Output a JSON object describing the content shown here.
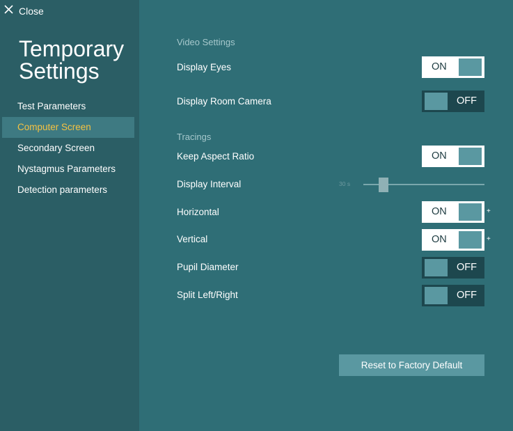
{
  "header": {
    "close_label": "Close"
  },
  "sidebar": {
    "title_line1": "Temporary",
    "title_line2": "Settings",
    "items": [
      {
        "label": "Test Parameters",
        "active": false
      },
      {
        "label": "Computer Screen",
        "active": true
      },
      {
        "label": "Secondary Screen",
        "active": false
      },
      {
        "label": "Nystagmus Parameters",
        "active": false
      },
      {
        "label": "Detection parameters",
        "active": false
      }
    ]
  },
  "video_settings": {
    "heading": "Video Settings",
    "display_eyes": {
      "label": "Display Eyes",
      "state": "ON"
    },
    "display_room_camera": {
      "label": "Display Room Camera",
      "state": "OFF"
    }
  },
  "tracings": {
    "heading": "Tracings",
    "keep_aspect_ratio": {
      "label": "Keep Aspect Ratio",
      "state": "ON"
    },
    "display_interval": {
      "label": "Display Interval",
      "value": "30 s"
    },
    "horizontal": {
      "label": "Horizontal",
      "state": "ON",
      "extra": "+"
    },
    "vertical": {
      "label": "Vertical",
      "state": "ON",
      "extra": "+"
    },
    "pupil_diameter": {
      "label": "Pupil Diameter",
      "state": "OFF"
    },
    "split_left_right": {
      "label": "Split Left/Right",
      "state": "OFF"
    }
  },
  "reset_button": {
    "label": "Reset to Factory Default"
  },
  "colors": {
    "sidebar_bg": "#2b5e65",
    "main_bg": "#2f6e76",
    "accent_active": "#f5c242",
    "toggle_on_bg": "#ffffff",
    "toggle_off_bg": "#1d474e",
    "knob": "#5a98a1",
    "button_bg": "#5a98a1"
  },
  "icons": {
    "close": "close-icon"
  }
}
